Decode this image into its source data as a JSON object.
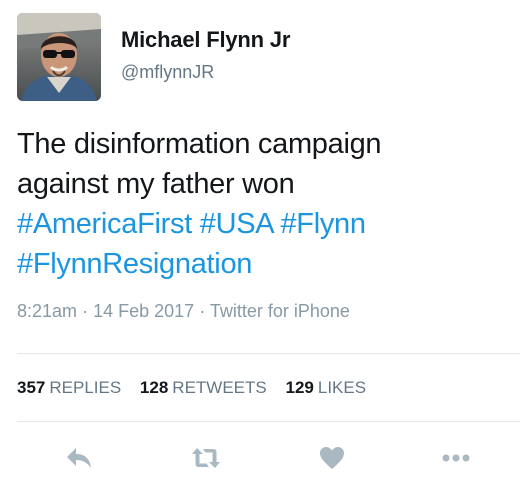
{
  "user": {
    "display_name": "Michael Flynn Jr",
    "handle": "@mflynnJR"
  },
  "tweet": {
    "line1": "The disinformation campaign",
    "line2": "against my father won",
    "hashtags_line1": [
      "#AmericaFirst",
      "#USA",
      "#Flynn"
    ],
    "hashtags_line2": [
      "#FlynnResignation"
    ],
    "time": "8:21am",
    "date": "14 Feb 2017",
    "source": "Twitter for iPhone",
    "separator": "·"
  },
  "stats": {
    "replies": {
      "count": "357",
      "label": "REPLIES"
    },
    "retweets": {
      "count": "128",
      "label": "RETWEETS"
    },
    "likes": {
      "count": "129",
      "label": "LIKES"
    }
  },
  "actions": {
    "reply_icon": "reply-icon",
    "retweet_icon": "retweet-icon",
    "like_icon": "heart-icon",
    "more_icon": "more-icon"
  },
  "colors": {
    "hashtag": "#1b95e0",
    "secondary_text": "#657786",
    "action_icon": "#aab8c2",
    "divider": "#e1e8ed"
  }
}
